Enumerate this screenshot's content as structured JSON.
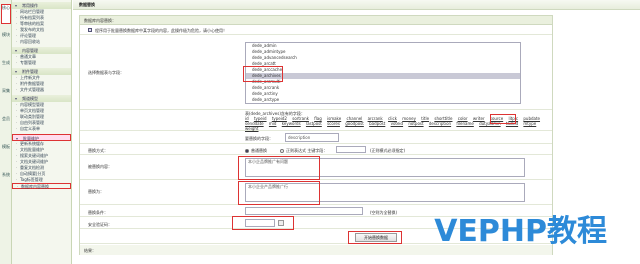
{
  "strip": {
    "tabs": [
      {
        "label": "核心",
        "active": true
      },
      {
        "label": "模块",
        "active": false
      },
      {
        "label": "生成",
        "active": false
      },
      {
        "label": "采集",
        "active": false
      },
      {
        "label": "会员",
        "active": false
      },
      {
        "label": "模板",
        "active": false
      },
      {
        "label": "系统",
        "active": false
      }
    ]
  },
  "sidebar": {
    "groups": [
      {
        "title": "常用操作",
        "hl": false,
        "items": [
          {
            "label": "网站栏目管理",
            "hl": false
          },
          {
            "label": "所有档案列表",
            "hl": false
          },
          {
            "label": "等审核的档案",
            "hl": false
          },
          {
            "label": "我发布的文档",
            "hl": false
          },
          {
            "label": "评论管理",
            "hl": false
          },
          {
            "label": "内容回收站",
            "hl": false
          }
        ]
      },
      {
        "title": "内容管理",
        "hl": false,
        "items": [
          {
            "label": "普通文章",
            "hl": false
          },
          {
            "label": "专题管理",
            "hl": false
          }
        ]
      },
      {
        "title": "附件管理",
        "hl": false,
        "items": [
          {
            "label": "上传新文件",
            "hl": false
          },
          {
            "label": "附件数据管理",
            "hl": false
          },
          {
            "label": "文件式管理器",
            "hl": false
          }
        ]
      },
      {
        "title": "频道模型",
        "hl": false,
        "items": [
          {
            "label": "内容模型管理",
            "hl": false
          },
          {
            "label": "单页文档管理",
            "hl": false
          },
          {
            "label": "联动类别管理",
            "hl": false
          },
          {
            "label": "自由列表管理",
            "hl": false
          },
          {
            "label": "自定义表单",
            "hl": false
          }
        ]
      },
      {
        "title": "批量维护",
        "hl": true,
        "items": [
          {
            "label": "更新系统缓存",
            "hl": false
          },
          {
            "label": "文档批量维护",
            "hl": false
          },
          {
            "label": "搜索关键词维护",
            "hl": false
          },
          {
            "label": "文档关键词维护",
            "hl": false
          },
          {
            "label": "重复文档检测",
            "hl": false
          },
          {
            "label": "自动摘要|分页",
            "hl": false
          },
          {
            "label": "Tag标签管理",
            "hl": false
          },
          {
            "label": "数据库内容替换",
            "hl": true
          }
        ]
      }
    ]
  },
  "main": {
    "title": "数据替换",
    "panel_title": "数据库内容替换：",
    "notice": "程序用于批量替换数据库中某字段的内容，此操作极为危险，请小心使用！",
    "select_label": "选择数据表与字段：",
    "tables": [
      "dede_admin",
      "dede_admintype",
      "dede_advancedsearch",
      "dede_arcatt",
      "dede_arccache",
      "dede_archives",
      "dede_arcmulti",
      "dede_arcrank",
      "dede_arctiny",
      "dede_arctype",
      "dede_area",
      "dede_co_htmls"
    ],
    "selected_table_index": 5,
    "fields_caption": "表(dede_archives)含有的字段：",
    "fields": [
      "id",
      "typeid",
      "typeid2",
      "sortrank",
      "flag",
      "ismake",
      "channel",
      "arcrank",
      "click",
      "money",
      "title",
      "shorttitle",
      "color",
      "writer",
      "source",
      "litpic",
      "pubdate",
      "senddate",
      "mid",
      "keywords",
      "lastpost",
      "scores",
      "goodpost",
      "badpost",
      "voteid",
      "notpost",
      "description",
      "filename",
      "dutyadmin",
      "tackid",
      "mtype",
      "weight"
    ],
    "highlight_field": "description",
    "target_label": "要替换的字段：",
    "target_value": "description",
    "mode_label": "替换方式：",
    "mode_normal": "普通替换",
    "mode_regex": "正则表达式 主键字段：",
    "mode_hint": "(正则模式必须指定)",
    "find_label": "被替换内容：",
    "find_value": "本小企品牌推广有问题",
    "replace_label": "替换为：",
    "replace_value": "本小企业产品牌推广行",
    "condition_label": "替换条件：",
    "condition_hint": "(空则为全替换)",
    "captcha_label": "安全验证码：",
    "submit_label": "开始替换数据",
    "result_label": "结果："
  },
  "watermark": "VEPHP教程"
}
